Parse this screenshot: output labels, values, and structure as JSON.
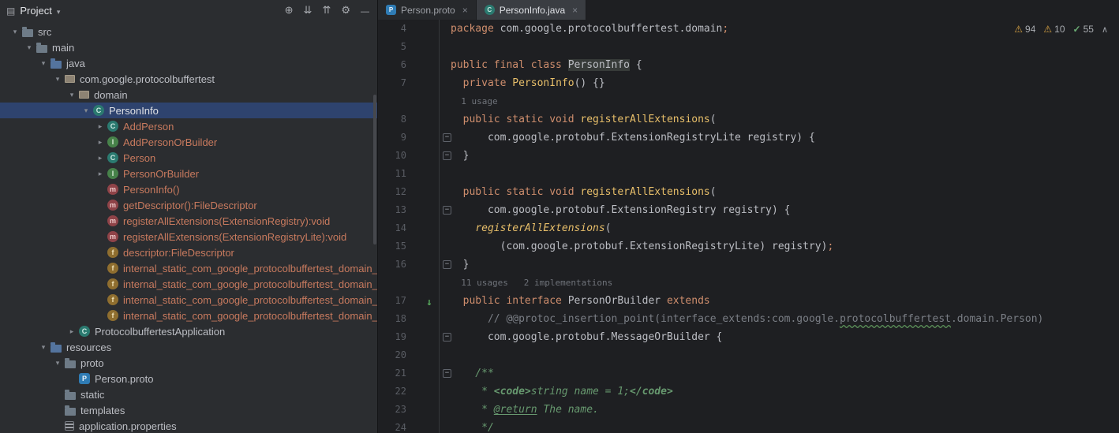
{
  "colors": {
    "selection": "#2E436E",
    "warning": "#D9A343",
    "success": "#6AAB73",
    "keyword": "#CF8E6D",
    "editor_background": "#1E1F22",
    "panel_background": "#2B2D30"
  },
  "project_panel": {
    "title": "Project",
    "toolbar": [
      "locate",
      "expand-all",
      "collapse-all",
      "settings",
      "hide"
    ],
    "tree": [
      {
        "label": "src",
        "icon": "folder",
        "depth": 1,
        "chevron": "down"
      },
      {
        "label": "main",
        "icon": "folder",
        "depth": 2,
        "chevron": "down"
      },
      {
        "label": "java",
        "icon": "folder-source",
        "depth": 3,
        "chevron": "down"
      },
      {
        "label": "com.google.protocolbuffertest",
        "icon": "package",
        "depth": 4,
        "chevron": "down"
      },
      {
        "label": "domain",
        "icon": "package",
        "depth": 5,
        "chevron": "down"
      },
      {
        "label": "PersonInfo",
        "icon": "class",
        "depth": 6,
        "chevron": "down",
        "selected": true
      },
      {
        "label": "AddPerson",
        "icon": "class",
        "depth": 7,
        "chevron": "right",
        "member": true
      },
      {
        "label": "AddPersonOrBuilder",
        "icon": "interface",
        "depth": 7,
        "chevron": "right",
        "member": true
      },
      {
        "label": "Person",
        "icon": "class",
        "depth": 7,
        "chevron": "right",
        "member": true
      },
      {
        "label": "PersonOrBuilder",
        "icon": "interface",
        "depth": 7,
        "chevron": "right",
        "member": true
      },
      {
        "label": "PersonInfo()",
        "icon": "method",
        "depth": 7,
        "member": true
      },
      {
        "label": "getDescriptor():FileDescriptor",
        "icon": "method",
        "depth": 7,
        "member": true
      },
      {
        "label": "registerAllExtensions(ExtensionRegistry):void",
        "icon": "method",
        "depth": 7,
        "member": true
      },
      {
        "label": "registerAllExtensions(ExtensionRegistryLite):void",
        "icon": "method",
        "depth": 7,
        "member": true
      },
      {
        "label": "descriptor:FileDescriptor",
        "icon": "field",
        "depth": 7,
        "member": true
      },
      {
        "label": "internal_static_com_google_protocolbuffertest_domain_Ad",
        "icon": "field",
        "depth": 7,
        "member": true
      },
      {
        "label": "internal_static_com_google_protocolbuffertest_domain_Ad",
        "icon": "field",
        "depth": 7,
        "member": true
      },
      {
        "label": "internal_static_com_google_protocolbuffertest_domain_Pe",
        "icon": "field",
        "depth": 7,
        "member": true
      },
      {
        "label": "internal_static_com_google_protocolbuffertest_domain_Pe",
        "icon": "field",
        "depth": 7,
        "member": true
      },
      {
        "label": "ProtocolbuffertestApplication",
        "icon": "class",
        "depth": 5,
        "chevron": "right"
      },
      {
        "label": "resources",
        "icon": "folder-source",
        "depth": 3,
        "chevron": "down"
      },
      {
        "label": "proto",
        "icon": "folder",
        "depth": 4,
        "chevron": "down"
      },
      {
        "label": "Person.proto",
        "icon": "proto-file",
        "depth": 5
      },
      {
        "label": "static",
        "icon": "folder",
        "depth": 4
      },
      {
        "label": "templates",
        "icon": "folder",
        "depth": 4
      },
      {
        "label": "application.properties",
        "icon": "properties",
        "depth": 4
      }
    ]
  },
  "editor": {
    "tabs": [
      {
        "label": "Person.proto",
        "icon": "proto-file",
        "active": false
      },
      {
        "label": "PersonInfo.java",
        "icon": "java-class",
        "active": true
      }
    ],
    "inspections": {
      "warnings": "94",
      "weak_warnings": "10",
      "passed": "55"
    },
    "lines": [
      {
        "num": "4",
        "segs": [
          [
            "kw",
            "package"
          ],
          [
            "d",
            " com.google.protocolbuffertest.domain"
          ],
          [
            "sc",
            ";"
          ]
        ]
      },
      {
        "num": "5",
        "segs": []
      },
      {
        "num": "6",
        "segs": [
          [
            "kw",
            "public final class"
          ],
          [
            "d",
            " "
          ],
          [
            "hl",
            "PersonInfo"
          ],
          [
            "d",
            " {"
          ]
        ]
      },
      {
        "num": "7",
        "segs": [
          [
            "d",
            "  "
          ],
          [
            "kw",
            "private"
          ],
          [
            "d",
            " "
          ],
          [
            "m",
            "PersonInfo"
          ],
          [
            "d",
            "() {}"
          ]
        ]
      },
      {
        "segs": [
          [
            "hint",
            "  1 usage"
          ]
        ]
      },
      {
        "num": "8",
        "segs": [
          [
            "d",
            "  "
          ],
          [
            "kw",
            "public static void"
          ],
          [
            "d",
            " "
          ],
          [
            "m",
            "registerAllExtensions"
          ],
          [
            "d",
            "("
          ]
        ]
      },
      {
        "num": "9",
        "fold": true,
        "segs": [
          [
            "d",
            "      com.google.protobuf.ExtensionRegistryLite registry) {"
          ]
        ]
      },
      {
        "num": "10",
        "fold": true,
        "segs": [
          [
            "d",
            "  }"
          ]
        ]
      },
      {
        "num": "11",
        "segs": []
      },
      {
        "num": "12",
        "segs": [
          [
            "d",
            "  "
          ],
          [
            "kw",
            "public static void"
          ],
          [
            "d",
            " "
          ],
          [
            "m",
            "registerAllExtensions"
          ],
          [
            "d",
            "("
          ]
        ]
      },
      {
        "num": "13",
        "fold": true,
        "segs": [
          [
            "d",
            "      com.google.protobuf.ExtensionRegistry registry) {"
          ]
        ]
      },
      {
        "num": "14",
        "segs": [
          [
            "d",
            "    "
          ],
          [
            "mi",
            "registerAllExtensions"
          ],
          [
            "d",
            "("
          ]
        ]
      },
      {
        "num": "15",
        "segs": [
          [
            "d",
            "        (com.google.protobuf.ExtensionRegistryLite) registry)"
          ],
          [
            "sc",
            ";"
          ]
        ]
      },
      {
        "num": "16",
        "fold": true,
        "segs": [
          [
            "d",
            "  }"
          ]
        ]
      },
      {
        "segs": [
          [
            "hint",
            "  11 usages   2 implementations"
          ]
        ]
      },
      {
        "num": "17",
        "impl": true,
        "segs": [
          [
            "d",
            "  "
          ],
          [
            "kw",
            "public interface"
          ],
          [
            "d",
            " PersonOrBuilder "
          ],
          [
            "kw",
            "extends"
          ]
        ]
      },
      {
        "num": "18",
        "segs": [
          [
            "d",
            "      "
          ],
          [
            "c",
            "// @@protoc_insertion_point(interface_extends:com.google."
          ],
          [
            "ct",
            "protocolbuffertest"
          ],
          [
            "c",
            ".domain.Person)"
          ]
        ]
      },
      {
        "num": "19",
        "fold": true,
        "segs": [
          [
            "d",
            "      com.google.protobuf.MessageOrBuilder {"
          ]
        ]
      },
      {
        "num": "20",
        "segs": []
      },
      {
        "num": "21",
        "fold": true,
        "segs": [
          [
            "doc",
            "    /**"
          ]
        ]
      },
      {
        "num": "22",
        "segs": [
          [
            "doc",
            "     * "
          ],
          [
            "doct",
            "<code>"
          ],
          [
            "doc",
            "string name = 1;"
          ],
          [
            "doct",
            "</code>"
          ]
        ]
      },
      {
        "num": "23",
        "segs": [
          [
            "doc",
            "     * "
          ],
          [
            "docu",
            "@return"
          ],
          [
            "doc",
            " The name."
          ]
        ]
      },
      {
        "num": "24",
        "segs": [
          [
            "doc",
            "     */"
          ]
        ]
      }
    ]
  }
}
